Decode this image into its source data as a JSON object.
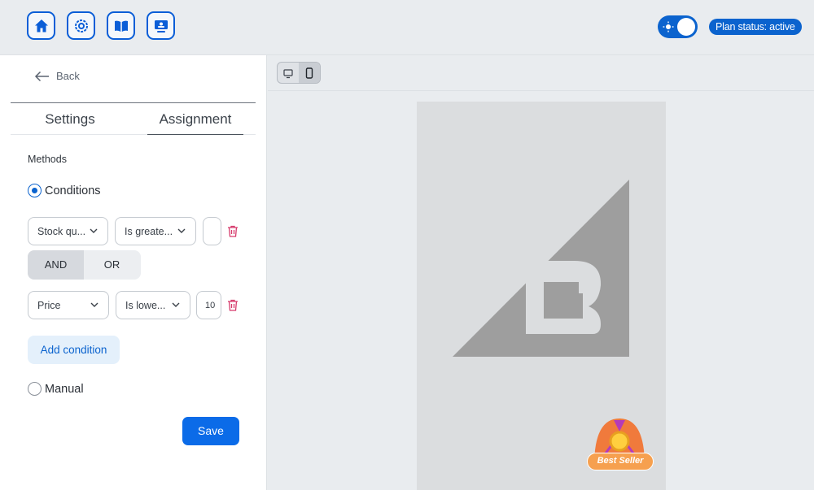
{
  "topbar": {
    "nav_icons": [
      "home-icon",
      "settings-icon",
      "book-icon",
      "display-icon"
    ],
    "theme_toggle": {
      "state": "on",
      "icon": "sun-icon"
    },
    "plan_status": "Plan status: active"
  },
  "sidebar": {
    "back_label": "Back",
    "tabs": [
      {
        "label": "Settings",
        "active": false
      },
      {
        "label": "Assignment",
        "active": true
      }
    ],
    "methods_label": "Methods",
    "method_conditions": "Conditions",
    "method_manual": "Manual",
    "selected_method": "Conditions",
    "conditions": [
      {
        "field": "Stock qu...",
        "operator": "Is greate...",
        "value": ""
      },
      {
        "field": "Price",
        "operator": "Is lowe...",
        "value": "10"
      }
    ],
    "logic": {
      "and_label": "AND",
      "or_label": "OR",
      "selected": "AND"
    },
    "add_condition_label": "Add condition",
    "save_label": "Save"
  },
  "preview": {
    "devices": [
      "desktop-icon",
      "mobile-icon"
    ],
    "active_device": "mobile",
    "badge_label": "Best Seller"
  },
  "colors": {
    "accent": "#0b63ce",
    "save_button": "#0b6be8",
    "delete_icon": "#d63a6c",
    "badge": "#f6a04f"
  }
}
